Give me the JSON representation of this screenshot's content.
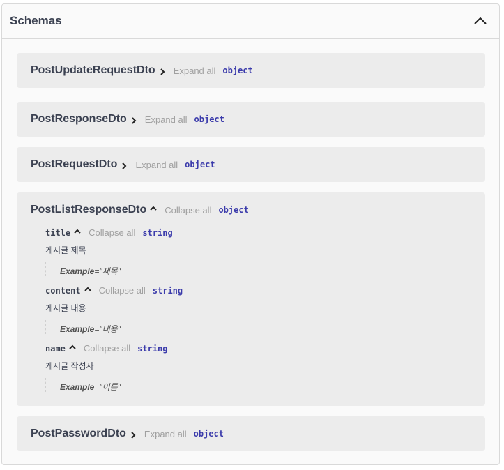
{
  "section": {
    "title": "Schemas"
  },
  "models": [
    {
      "name": "PostUpdateRequestDto",
      "toggle": "Expand all",
      "type": "object"
    },
    {
      "name": "PostResponseDto",
      "toggle": "Expand all",
      "type": "object"
    },
    {
      "name": "PostRequestDto",
      "toggle": "Expand all",
      "type": "object"
    },
    {
      "name": "PostListResponseDto",
      "toggle": "Collapse all",
      "type": "object",
      "properties": [
        {
          "name": "title",
          "toggle": "Collapse all",
          "type": "string",
          "description": "게시글 제목",
          "example_label": "Example",
          "example_value": "=\"제목\""
        },
        {
          "name": "content",
          "toggle": "Collapse all",
          "type": "string",
          "description": "게시글 내용",
          "example_label": "Example",
          "example_value": "=\"내용\""
        },
        {
          "name": "name",
          "toggle": "Collapse all",
          "type": "string",
          "description": "게시글 작성자",
          "example_label": "Example",
          "example_value": "=\"이름\""
        }
      ]
    },
    {
      "name": "PostPasswordDto",
      "toggle": "Expand all",
      "type": "object"
    }
  ],
  "icons": {
    "section_toggle": "chevron-up-icon",
    "expand": "chevron-right-icon",
    "collapse": "chevron-up-icon"
  }
}
